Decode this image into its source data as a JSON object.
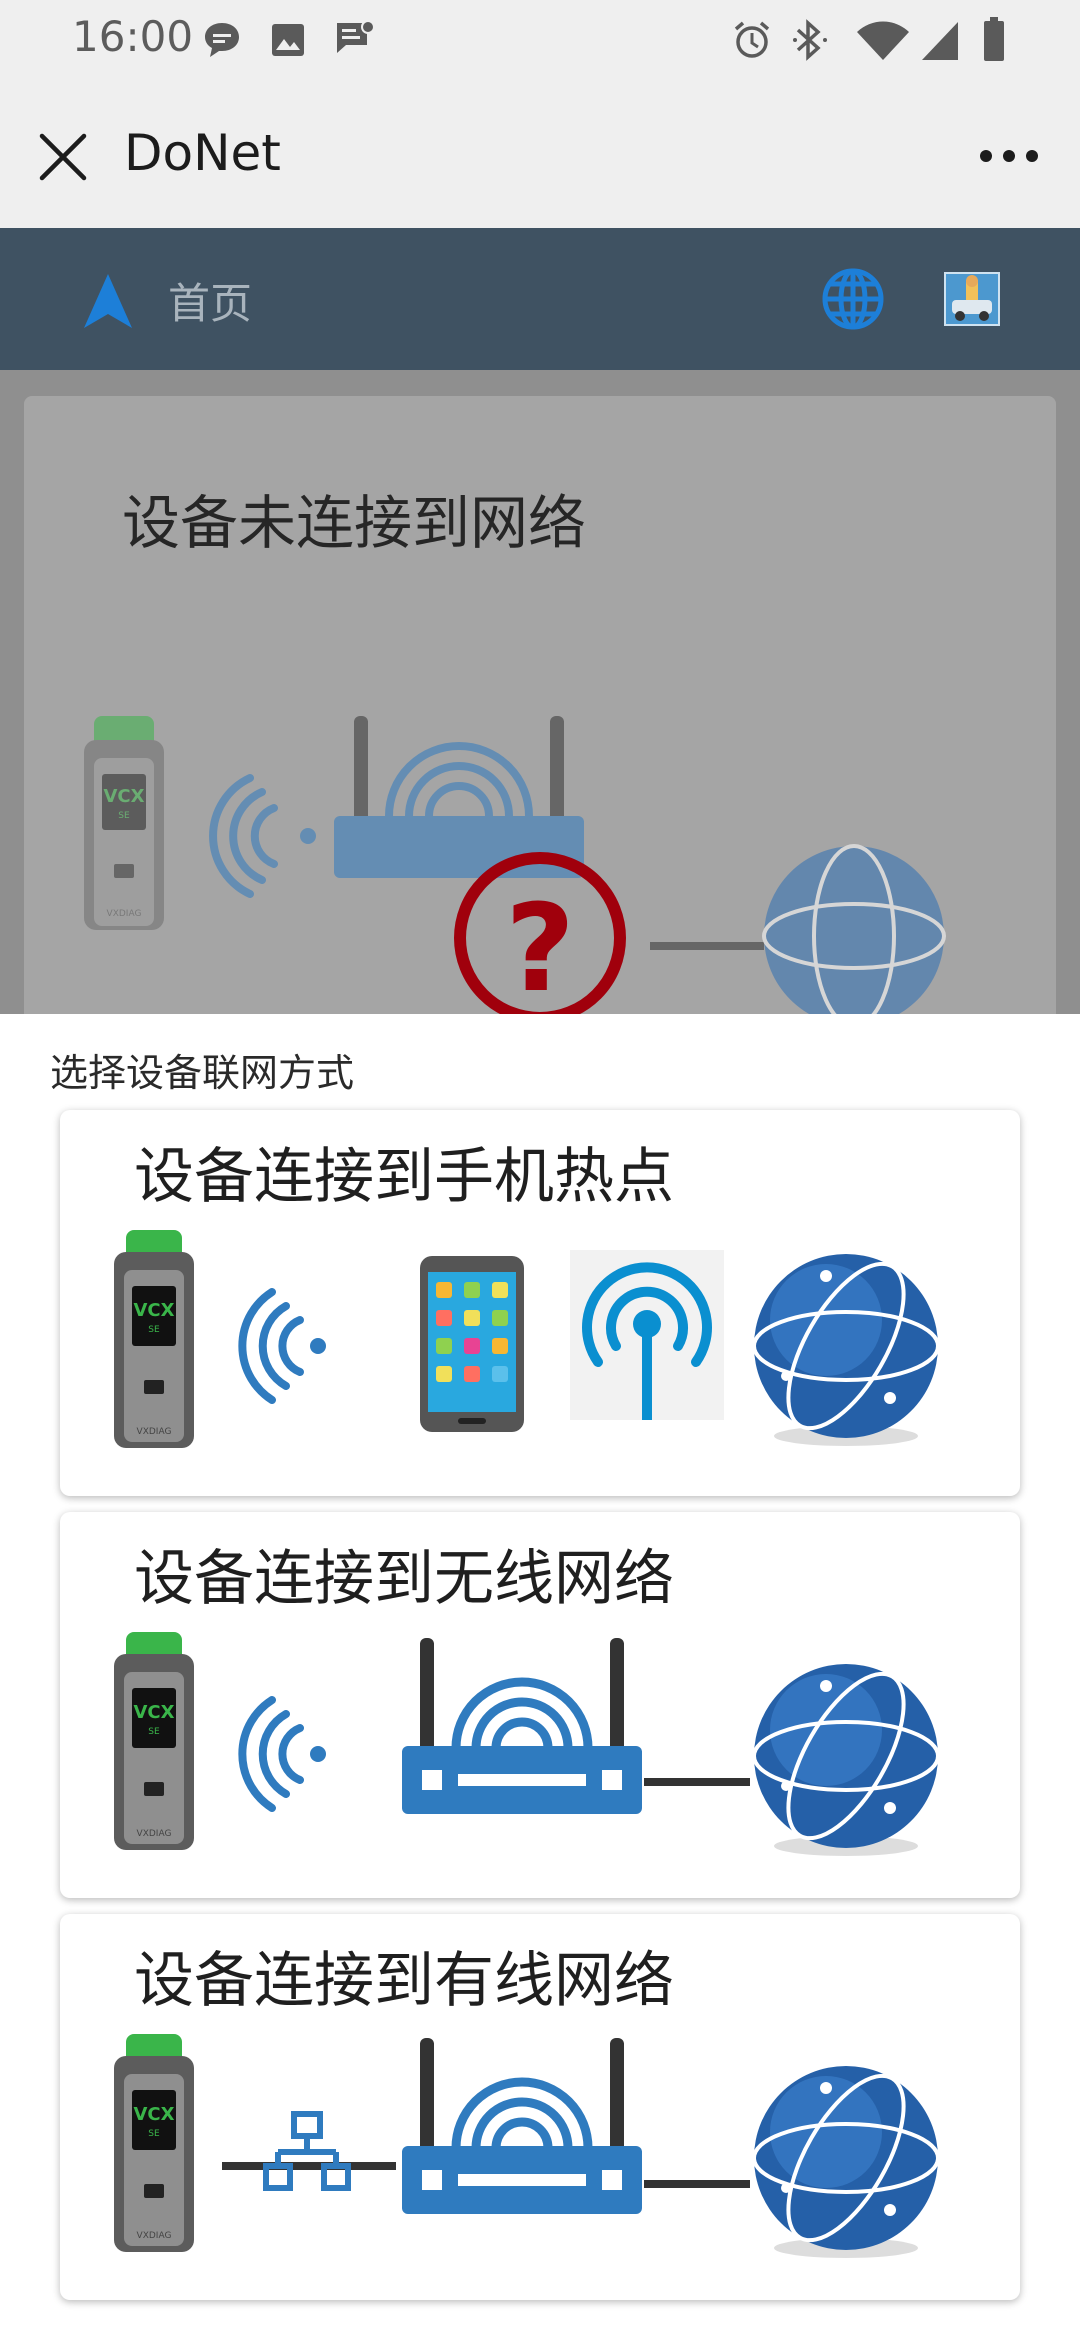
{
  "status_bar": {
    "time": "16:00",
    "left_icons": [
      "message-icon",
      "image-icon",
      "chat-notification-icon"
    ],
    "right_icons": [
      "alarm-icon",
      "bluetooth-icon",
      "wifi-icon",
      "cellular-signal-icon",
      "battery-icon"
    ]
  },
  "title_bar": {
    "title": "DoNet",
    "close_icon": "close-icon",
    "more_icon": "more-options-icon"
  },
  "nav": {
    "home_label": "首页",
    "logo_icon": "navigation-arrow-icon",
    "globe_icon": "globe-icon",
    "avatar_icon": "user-avatar-icon"
  },
  "status_card": {
    "title": "设备未连接到网络",
    "device_brand": "VCX",
    "device_model": "SE",
    "device_maker": "VXDIAG"
  },
  "sheet": {
    "title": "选择设备联网方式",
    "options": [
      {
        "label": "设备连接到手机热点"
      },
      {
        "label": "设备连接到无线网络"
      },
      {
        "label": "设备连接到有线网络"
      }
    ]
  },
  "colors": {
    "nav_bg": "#3f5262",
    "router_blue": "#2f7bbf",
    "device_green": "#3ab54a",
    "error_red": "#a0000c",
    "hotspot_blue": "#0a8fd0"
  }
}
